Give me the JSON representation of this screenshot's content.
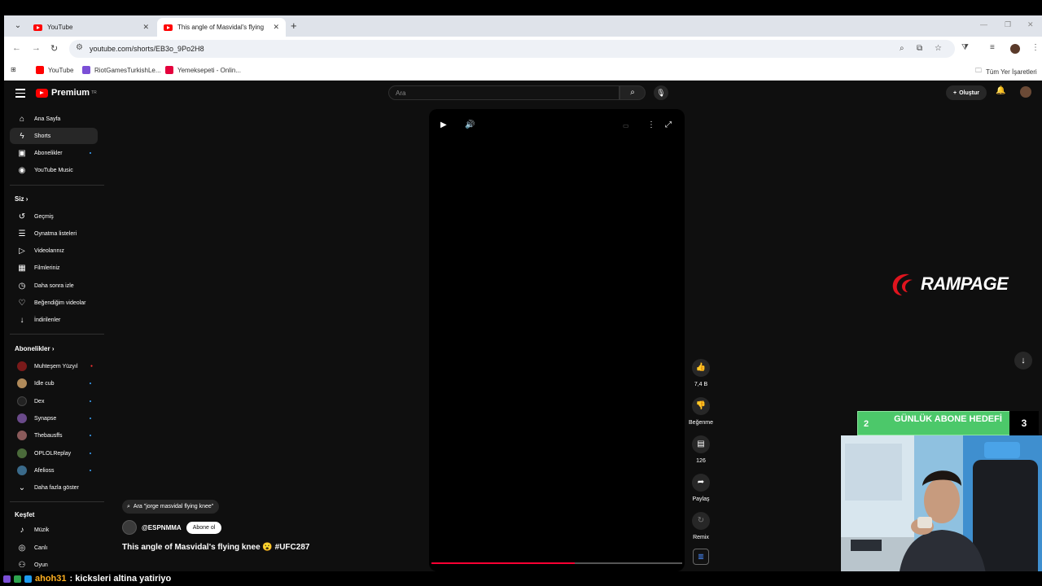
{
  "browser": {
    "tabs": [
      {
        "title": "YouTube",
        "active": false
      },
      {
        "title": "This angle of Masvidal's flying",
        "active": true
      }
    ],
    "new_tab_symbol": "+",
    "url": "youtube.com/shorts/EB3o_9Po2H8",
    "bookmarks": [
      {
        "label": "YouTube",
        "color": "#ff0000"
      },
      {
        "label": "RiotGamesTurkishLe...",
        "color": "#7b4fd6"
      },
      {
        "label": "Yemeksepeti - Onlin...",
        "color": "#e4003c"
      }
    ],
    "all_bookmarks_label": "Tüm Yer İşaretleri"
  },
  "youtube": {
    "logo_text": "Premium",
    "logo_country": "TR",
    "search_placeholder": "Ara",
    "create_label": "Oluştur",
    "sidebar": {
      "main": [
        {
          "label": "Ana Sayfa",
          "icon": "home-icon",
          "glyph": "⌂"
        },
        {
          "label": "Shorts",
          "icon": "shorts-icon",
          "glyph": "ϟ",
          "selected": true
        },
        {
          "label": "Abonelikler",
          "icon": "subscriptions-icon",
          "glyph": "▣",
          "dot": true
        },
        {
          "label": "YouTube Music",
          "icon": "music-icon",
          "glyph": "◉"
        }
      ],
      "you_header": "Siz",
      "you": [
        {
          "label": "Geçmiş",
          "icon": "history-icon",
          "glyph": "↺"
        },
        {
          "label": "Oynatma listeleri",
          "icon": "playlists-icon",
          "glyph": "☰"
        },
        {
          "label": "Videolarınız",
          "icon": "your-videos-icon",
          "glyph": "▷"
        },
        {
          "label": "Filmleriniz",
          "icon": "movies-icon",
          "glyph": "▦"
        },
        {
          "label": "Daha sonra izle",
          "icon": "watch-later-icon",
          "glyph": "◷"
        },
        {
          "label": "Beğendiğim videolar",
          "icon": "liked-icon",
          "glyph": "♡"
        },
        {
          "label": "İndirilenler",
          "icon": "downloads-icon",
          "glyph": "↓"
        }
      ],
      "subs_header": "Abonelikler",
      "subs": [
        {
          "label": "Muhteşem Yüzyıl",
          "color": "#7a1a1a",
          "live": true
        },
        {
          "label": "Idle cub",
          "color": "#b08a5a",
          "dot": true
        },
        {
          "label": "Dex",
          "color": "#222222",
          "dot": true
        },
        {
          "label": "Synapse",
          "color": "#6a4a8a",
          "dot": true
        },
        {
          "label": "Thebausffs",
          "color": "#8a5a5a",
          "dot": true
        },
        {
          "label": "OPLOLReplay",
          "color": "#4a6a3a",
          "dot": true
        },
        {
          "label": "Afelioss",
          "color": "#3a6a8a",
          "dot": true
        }
      ],
      "show_more": "Daha fazla göster",
      "explore_header": "Keşfet",
      "explore": [
        {
          "label": "Müzik",
          "icon": "music-note-icon",
          "glyph": "♪"
        },
        {
          "label": "Canlı",
          "icon": "live-icon",
          "glyph": "◎"
        },
        {
          "label": "Oyun",
          "icon": "gaming-icon",
          "glyph": "⚇"
        }
      ]
    },
    "short": {
      "search_chip": "Ara \"jorge masvidal flying knee\"",
      "channel": "@ESPNMMA",
      "subscribe_label": "Abone ol",
      "title": "This angle of Masvidal's flying knee 😮 #UFC287",
      "progress": 0.57,
      "reactions": {
        "likes": "7,4 B",
        "dislike": "Beğenme",
        "comments": "126",
        "share": "Paylaş",
        "remix": "Remix"
      }
    }
  },
  "stream_overlay": {
    "sponsor": "RAMPAGE",
    "goal_title": "GÜNLÜK ABONE HEDEFİ",
    "goal_current": "2",
    "goal_target": "3",
    "chat_user": "ahoh31",
    "chat_message": ": kicksleri altina yatiriyo"
  }
}
